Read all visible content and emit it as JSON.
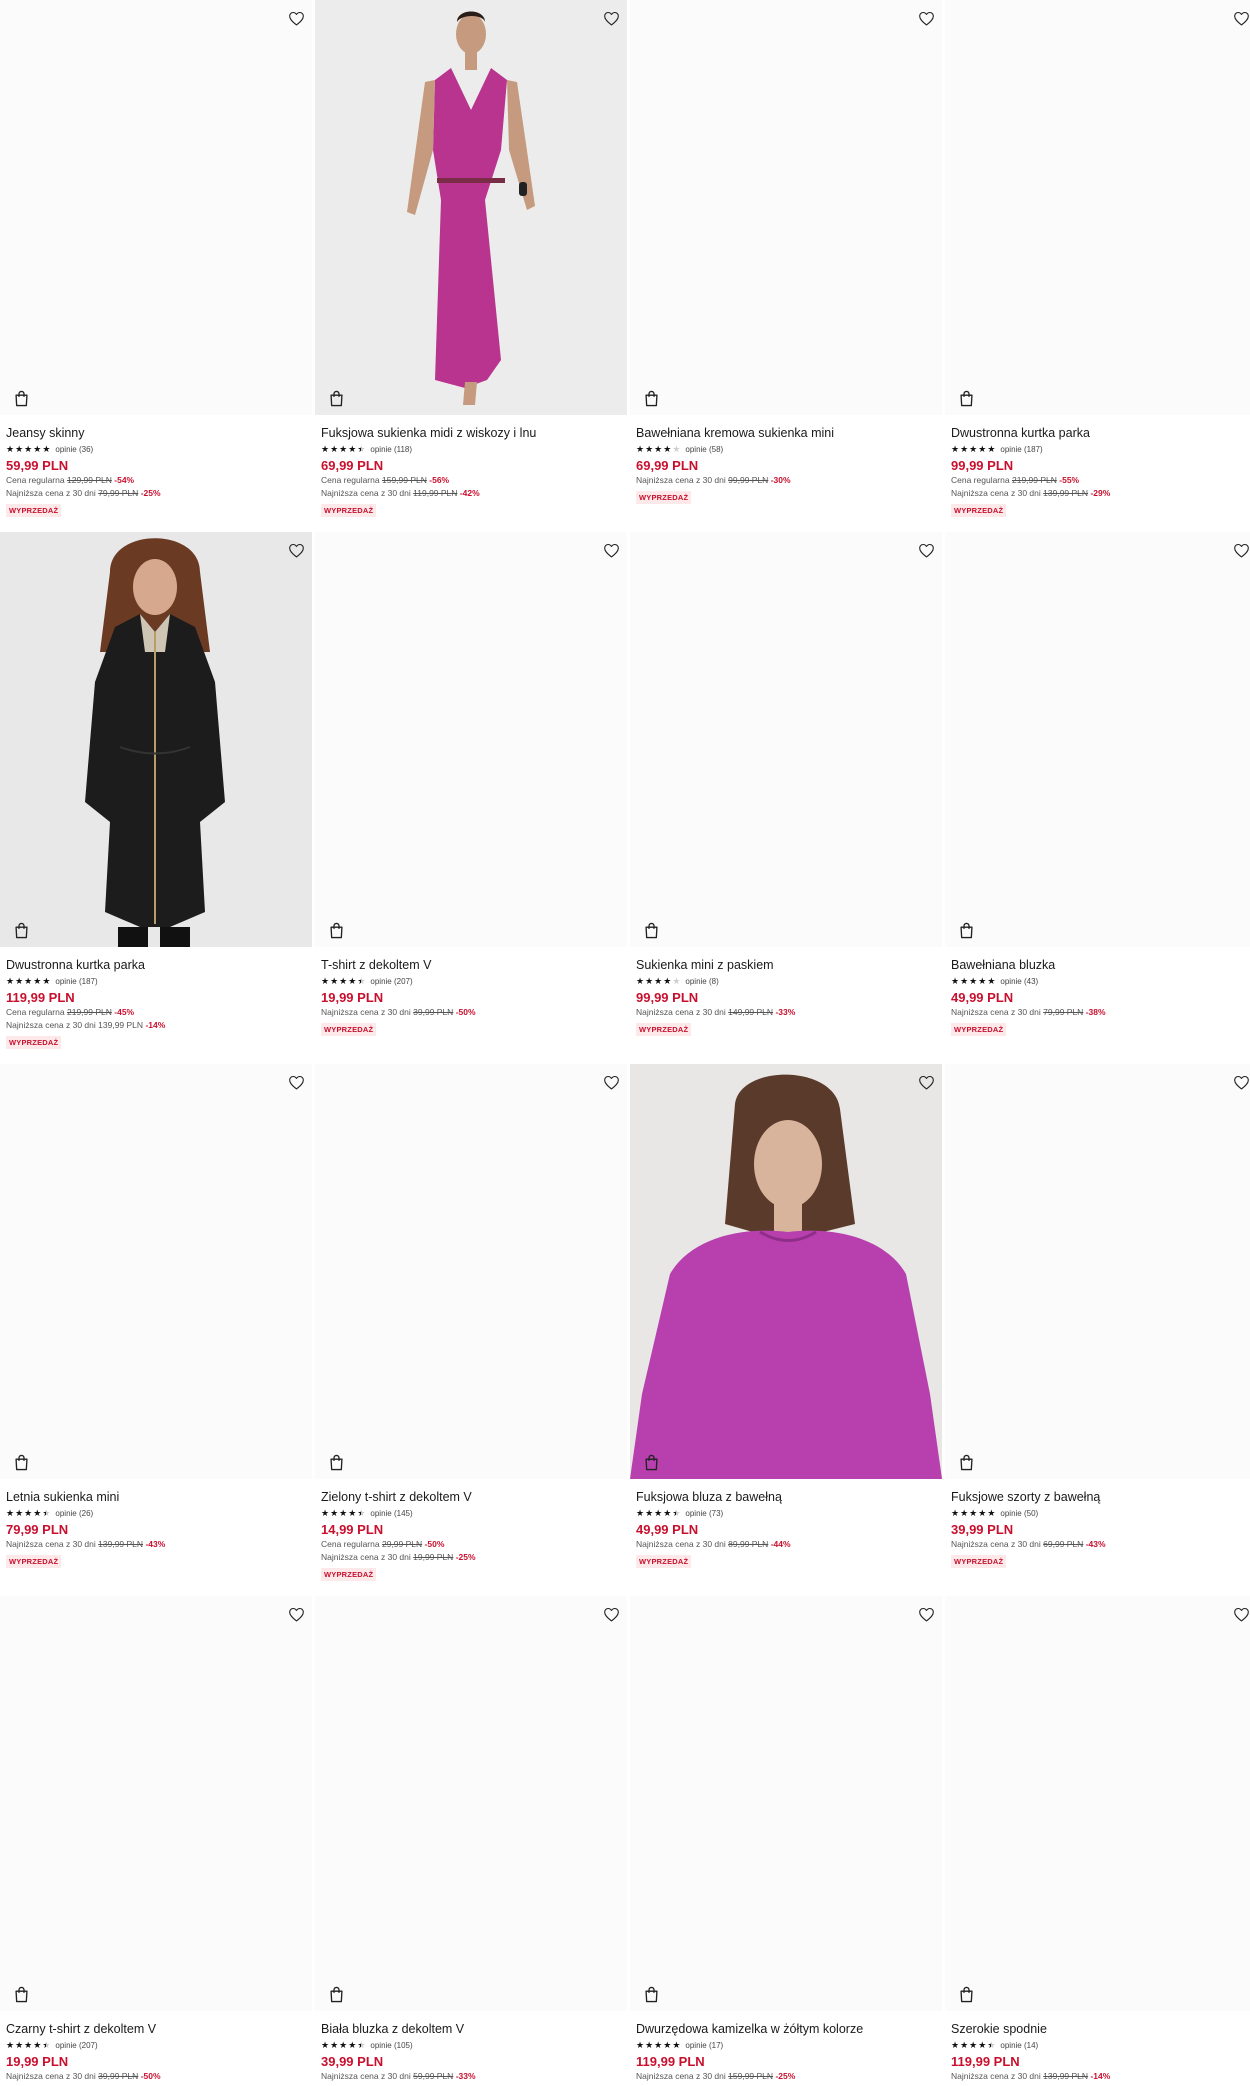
{
  "labels": {
    "reviews_prefix": "opinie",
    "sale_badge": "WYPRZEDAŻ",
    "regular_price_prefix": "Cena regularna",
    "lowest_price_prefix": "Najniższa cena z 30 dni"
  },
  "products": [
    {
      "name": "Jeansy skinny",
      "rating": 5,
      "reviews": "opinie (36)",
      "price": "59,99 PLN",
      "regular": "129,99 PLN",
      "regular_disc": "-54%",
      "lowest": "79,99 PLN",
      "lowest_disc": "-25%",
      "badge": "WYPRZEDAŻ",
      "image": "none"
    },
    {
      "name": "Fuksjowa sukienka midi z wiskozy i lnu",
      "rating": 4.5,
      "reviews": "opinie (118)",
      "price": "69,99 PLN",
      "regular": "159,99 PLN",
      "regular_disc": "-56%",
      "lowest": "119,99 PLN",
      "lowest_disc": "-42%",
      "badge": "WYPRZEDAŻ",
      "image": "dress"
    },
    {
      "name": "Bawełniana kremowa sukienka mini",
      "rating": 4,
      "reviews": "opinie (58)",
      "price": "69,99 PLN",
      "regular": null,
      "regular_disc": null,
      "lowest": "99,99 PLN",
      "lowest_disc": "-30%",
      "badge": "WYPRZEDAŻ",
      "image": "none"
    },
    {
      "name": "Dwustronna kurtka parka",
      "rating": 5,
      "reviews": "opinie (187)",
      "price": "99,99 PLN",
      "regular": "219,99 PLN",
      "regular_disc": "-55%",
      "lowest": "139,99 PLN",
      "lowest_disc": "-29%",
      "badge": "WYPRZEDAŻ",
      "image": "none"
    },
    {
      "name": "Dwustronna kurtka parka",
      "rating": 5,
      "reviews": "opinie (187)",
      "price": "119,99 PLN",
      "regular": "219,99 PLN",
      "regular_disc": "-45%",
      "lowest": "139,99 PLN",
      "lowest_plain": true,
      "lowest_disc": "-14%",
      "badge": "WYPRZEDAŻ",
      "image": "parka"
    },
    {
      "name": "T-shirt z dekoltem V",
      "rating": 4.5,
      "reviews": "opinie (207)",
      "price": "19,99 PLN",
      "regular": null,
      "regular_disc": null,
      "lowest": "39,99 PLN",
      "lowest_disc": "-50%",
      "badge": "WYPRZEDAŻ",
      "image": "none"
    },
    {
      "name": "Sukienka mini z paskiem",
      "rating": 4,
      "reviews": "opinie (8)",
      "price": "99,99 PLN",
      "regular": null,
      "regular_disc": null,
      "lowest": "149,99 PLN",
      "lowest_disc": "-33%",
      "badge": "WYPRZEDAŻ",
      "image": "none"
    },
    {
      "name": "Bawełniana bluzka",
      "rating": 5,
      "reviews": "opinie (43)",
      "price": "49,99 PLN",
      "regular": null,
      "regular_disc": null,
      "lowest": "79,99 PLN",
      "lowest_disc": "-38%",
      "badge": "WYPRZEDAŻ",
      "image": "none"
    },
    {
      "name": "Letnia sukienka mini",
      "rating": 4.5,
      "reviews": "opinie (26)",
      "price": "79,99 PLN",
      "regular": null,
      "regular_disc": null,
      "lowest": "139,99 PLN",
      "lowest_disc": "-43%",
      "badge": "WYPRZEDAŻ",
      "image": "none"
    },
    {
      "name": "Zielony t-shirt z dekoltem V",
      "rating": 4.5,
      "reviews": "opinie (145)",
      "price": "14,99 PLN",
      "regular": "29,99 PLN",
      "regular_disc": "-50%",
      "lowest": "19,99 PLN",
      "lowest_disc": "-25%",
      "badge": "WYPRZEDAŻ",
      "image": "none"
    },
    {
      "name": "Fuksjowa bluza z bawełną",
      "rating": 4.5,
      "reviews": "opinie (73)",
      "price": "49,99 PLN",
      "regular": null,
      "regular_disc": null,
      "lowest": "89,99 PLN",
      "lowest_disc": "-44%",
      "badge": "WYPRZEDAŻ",
      "image": "sweatshirt"
    },
    {
      "name": "Fuksjowe szorty z bawełną",
      "rating": 5,
      "reviews": "opinie (50)",
      "price": "39,99 PLN",
      "regular": null,
      "regular_disc": null,
      "lowest": "69,99 PLN",
      "lowest_disc": "-43%",
      "badge": "WYPRZEDAŻ",
      "image": "none"
    },
    {
      "name": "Czarny t-shirt z dekoltem V",
      "rating": 4.5,
      "reviews": "opinie (207)",
      "price": "19,99 PLN",
      "regular": null,
      "regular_disc": null,
      "lowest": "39,99 PLN",
      "lowest_disc": "-50%",
      "badge": null,
      "image": "none"
    },
    {
      "name": "Biała bluzka z dekoltem V",
      "rating": 4.5,
      "reviews": "opinie (105)",
      "price": "39,99 PLN",
      "regular": null,
      "regular_disc": null,
      "lowest": "59,99 PLN",
      "lowest_disc": "-33%",
      "badge": null,
      "image": "none"
    },
    {
      "name": "Dwurzędowa kamizelka w żółtym kolorze",
      "rating": 5,
      "reviews": "opinie (17)",
      "price": "119,99 PLN",
      "regular": null,
      "regular_disc": null,
      "lowest": "159,99 PLN",
      "lowest_disc": "-25%",
      "badge": null,
      "image": "none"
    },
    {
      "name": "Szerokie spodnie",
      "rating": 4.5,
      "reviews": "opinie (14)",
      "price": "119,99 PLN",
      "regular": null,
      "regular_disc": null,
      "lowest": "139,99 PLN",
      "lowest_disc": "-14%",
      "badge": null,
      "image": "none"
    }
  ],
  "colors": {
    "accent": "#c8102e",
    "badge_bg": "#fde8ea",
    "fuchsia": "#b8348f"
  },
  "icons": {
    "favorite": "heart-outline-icon",
    "bag": "shopping-bag-icon",
    "star": "star-icon"
  }
}
